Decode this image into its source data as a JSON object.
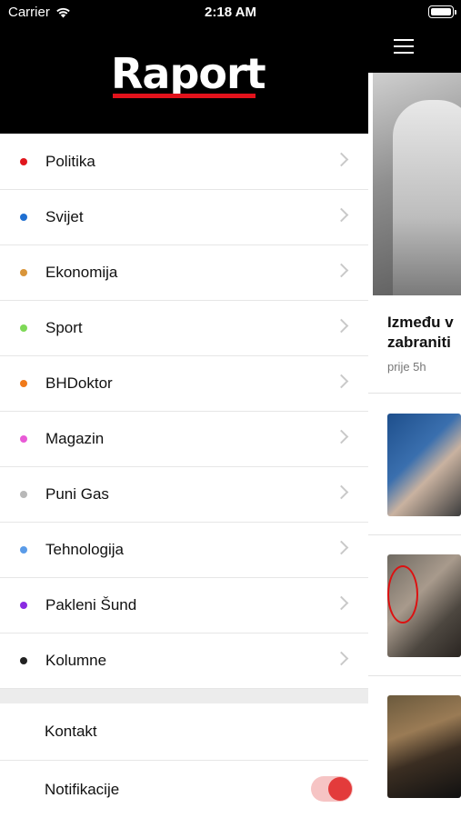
{
  "status_bar": {
    "carrier": "Carrier",
    "time": "2:18 AM"
  },
  "app": {
    "logo_text": "Raport",
    "brand_color": "#e2121b"
  },
  "menu": {
    "categories": [
      {
        "label": "Politika",
        "color": "#e0161d"
      },
      {
        "label": "Svijet",
        "color": "#1f6fd1"
      },
      {
        "label": "Ekonomija",
        "color": "#d9953a"
      },
      {
        "label": "Sport",
        "color": "#7ed957"
      },
      {
        "label": "BHDoktor",
        "color": "#f07a1a"
      },
      {
        "label": "Magazin",
        "color": "#e85ad6"
      },
      {
        "label": "Puni Gas",
        "color": "#b8b8b8"
      },
      {
        "label": "Tehnologija",
        "color": "#5a9be8"
      },
      {
        "label": "Pakleni Šund",
        "color": "#8a2be2"
      },
      {
        "label": "Kolumne",
        "color": "#222222"
      }
    ],
    "contact_label": "Kontakt",
    "notifications_label": "Notifikacije",
    "notifications_enabled": true
  },
  "main": {
    "hero_title_line1": "Između v",
    "hero_title_line2": "zabraniti",
    "hero_time": "prije 5h"
  }
}
